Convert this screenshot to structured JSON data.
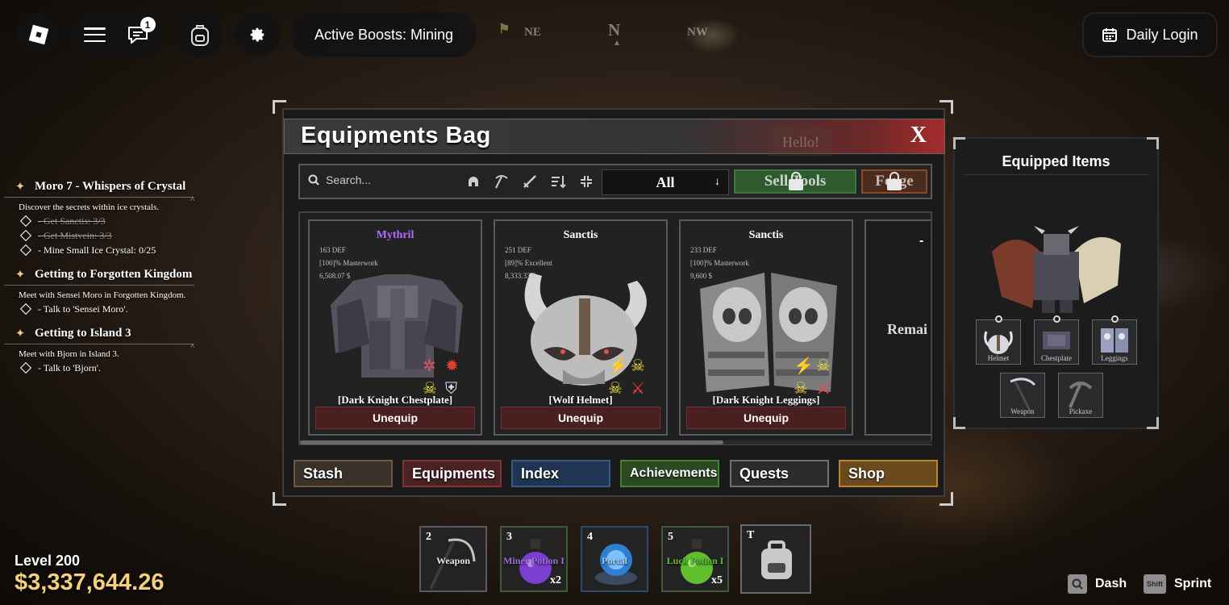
{
  "topbar": {
    "chat_badge": "1",
    "active_boosts": "Active Boosts: Mining",
    "daily_login": "Daily Login",
    "compass": {
      "left": "NE",
      "center": "N",
      "right": "NW"
    }
  },
  "quests": [
    {
      "title": "Moro 7 - Whispers of Crystal",
      "description": "Discover the secrets within ice crystals.",
      "objectives": [
        {
          "text": "- Get Sanctis: 3/3",
          "done": true
        },
        {
          "text": "- Get Mistvein: 3/3",
          "done": true
        },
        {
          "text": "- Mine Small Ice Crystal: 0/25",
          "done": false
        }
      ]
    },
    {
      "title": "Getting to Forgotten Kingdom",
      "description": "Meet with Sensei Moro in Forgotten Kingdom.",
      "objectives": [
        {
          "text": "- Talk to 'Sensei Moro'.",
          "done": false
        }
      ]
    },
    {
      "title": "Getting to Island 3",
      "description": "Meet with Bjorn in Island 3.",
      "objectives": [
        {
          "text": "- Talk to 'Bjorn'.",
          "done": false
        }
      ]
    }
  ],
  "bag": {
    "title": "Equipments Bag",
    "close": "X",
    "ghost_text": "Hello!",
    "search_placeholder": "Search...",
    "filter": "All",
    "sell_label": "Sell Tools",
    "forge_label": "Forge",
    "items": [
      {
        "rarity": "Mythril",
        "rarity_color": "#b36bff",
        "stats": [
          "163 DEF",
          "[100]% Masterwork",
          "6,508.07 $"
        ],
        "name": "[Dark Knight Chestplate]",
        "button": "Unequip"
      },
      {
        "rarity": "Sanctis",
        "rarity_color": "#ffffff",
        "stats": [
          "251 DEF",
          "[89]% Excellent",
          "8,333.33 $"
        ],
        "name": "[Wolf Helmet]",
        "button": "Unequip"
      },
      {
        "rarity": "Sanctis",
        "rarity_color": "#ffffff",
        "stats": [
          "233 DEF",
          "[100]% Masterwork",
          "9,600 $"
        ],
        "name": "[Dark Knight Leggings]",
        "button": "Unequip"
      }
    ],
    "partial_card": {
      "dash": "-",
      "text": "Remai"
    },
    "scroll_fraction": 0.67,
    "tabs": [
      {
        "label": "Stash",
        "bg": "#3a3229",
        "border": "#6d5a44"
      },
      {
        "label": "Equipments",
        "bg": "#4a2224",
        "border": "#7c3236"
      },
      {
        "label": "Index",
        "bg": "#1f3552",
        "border": "#34598a"
      },
      {
        "label": "Achievements",
        "bg": "#2b4a22",
        "border": "#4a7c36"
      },
      {
        "label": "Quests",
        "bg": "#2c2c2e",
        "border": "#707072"
      },
      {
        "label": "Shop",
        "bg": "#6b4a1d",
        "border": "#b88434"
      }
    ]
  },
  "equipped": {
    "title": "Equipped Items",
    "slots": [
      "Helmet",
      "Chestplate",
      "Leggings",
      "Weapon",
      "Pickaxe"
    ]
  },
  "player": {
    "level": "Level 200",
    "money": "$3,337,644.26"
  },
  "hotbar": [
    {
      "key": "2",
      "label": "Weapon",
      "label_color": "#e8e8e8",
      "qty": "",
      "border": "#5a5a5c"
    },
    {
      "key": "3",
      "label": "Miner Potion I",
      "label_color": "#a070e0",
      "qty": "x2",
      "border": "#3f5a3a"
    },
    {
      "key": "4",
      "label": "Portal",
      "label_color": "#9fd0ff",
      "qty": "",
      "border": "#2a4a6a"
    },
    {
      "key": "5",
      "label": "Luck Potion I",
      "label_color": "#5fbf3f",
      "qty": "x5",
      "border": "#3f5a3a"
    },
    {
      "key": "T",
      "label": "",
      "label_color": "#fff",
      "qty": "",
      "border": "#6a6a6c"
    }
  ],
  "hints": [
    {
      "key": "Q",
      "action": "Dash"
    },
    {
      "key": "Shift",
      "action": "Sprint"
    }
  ]
}
